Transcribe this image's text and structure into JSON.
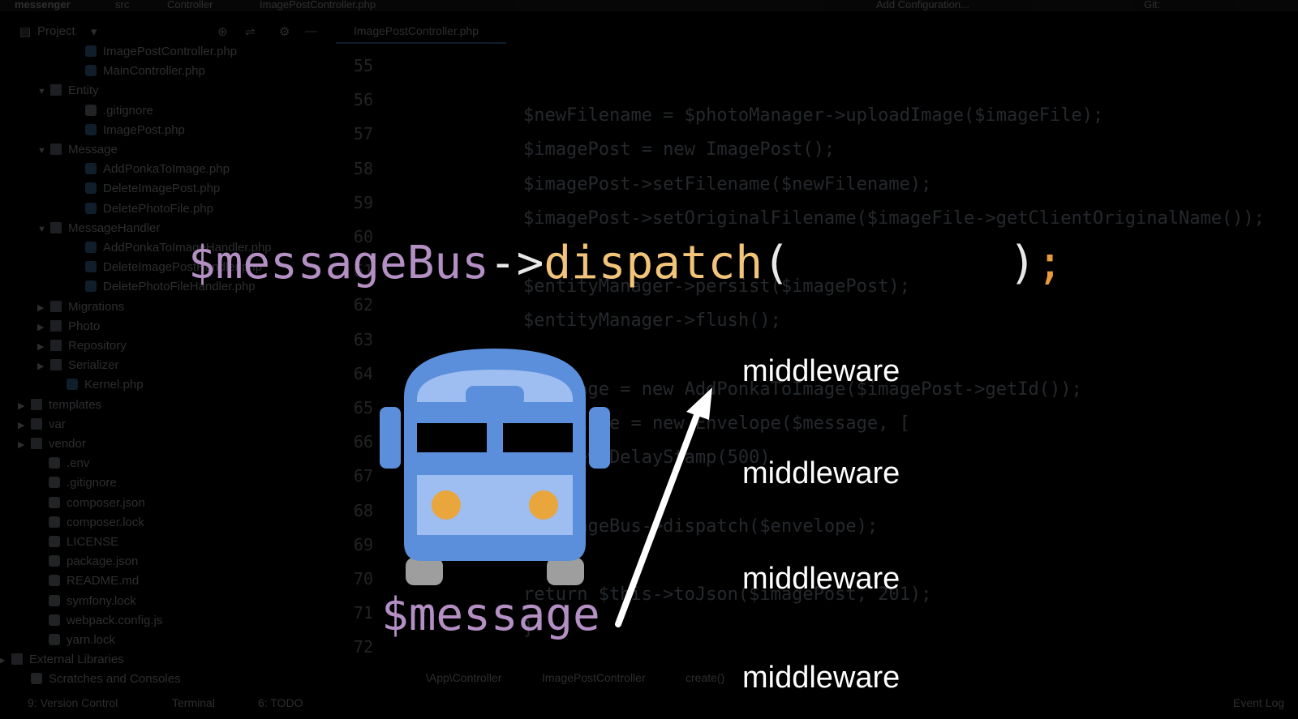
{
  "ide": {
    "topbar": {
      "project": "messenger",
      "path": [
        "src",
        "Controller",
        "ImagePostController.php"
      ],
      "config": "Add Configuration...",
      "git": "Git:"
    },
    "toolbar": {
      "project_label": "Project"
    },
    "editor_tab": "ImagePostController.php",
    "tree": [
      {
        "label": "ImagePostController.php",
        "kind": "php",
        "indent": 105
      },
      {
        "label": "MainController.php",
        "kind": "php",
        "indent": 105
      },
      {
        "label": "Entity",
        "kind": "folder",
        "indent": 62,
        "open": true
      },
      {
        "label": ".gitignore",
        "kind": "file",
        "indent": 105
      },
      {
        "label": "ImagePost.php",
        "kind": "php",
        "indent": 105
      },
      {
        "label": "Message",
        "kind": "folder",
        "indent": 62,
        "open": true
      },
      {
        "label": "AddPonkaToImage.php",
        "kind": "php",
        "indent": 105
      },
      {
        "label": "DeleteImagePost.php",
        "kind": "php",
        "indent": 105
      },
      {
        "label": "DeletePhotoFile.php",
        "kind": "php",
        "indent": 105
      },
      {
        "label": "MessageHandler",
        "kind": "folder",
        "indent": 62,
        "open": true
      },
      {
        "label": "AddPonkaToImageHandler.php",
        "kind": "php",
        "indent": 105
      },
      {
        "label": "DeleteImagePostHandler.php",
        "kind": "php",
        "indent": 105
      },
      {
        "label": "DeletePhotoFileHandler.php",
        "kind": "php",
        "indent": 105
      },
      {
        "label": "Migrations",
        "kind": "folder",
        "indent": 62,
        "open": false
      },
      {
        "label": "Photo",
        "kind": "folder",
        "indent": 62,
        "open": false
      },
      {
        "label": "Repository",
        "kind": "folder",
        "indent": 62,
        "open": false
      },
      {
        "label": "Serializer",
        "kind": "folder",
        "indent": 62,
        "open": false
      },
      {
        "label": "Kernel.php",
        "kind": "php",
        "indent": 82
      },
      {
        "label": "templates",
        "kind": "folder",
        "indent": 38,
        "open": false
      },
      {
        "label": "var",
        "kind": "folder",
        "indent": 38,
        "open": false
      },
      {
        "label": "vendor",
        "kind": "folder",
        "indent": 38,
        "open": false
      },
      {
        "label": ".env",
        "kind": "file",
        "indent": 60
      },
      {
        "label": ".gitignore",
        "kind": "file",
        "indent": 60
      },
      {
        "label": "composer.json",
        "kind": "file",
        "indent": 60
      },
      {
        "label": "composer.lock",
        "kind": "file",
        "indent": 60
      },
      {
        "label": "LICENSE",
        "kind": "file",
        "indent": 60
      },
      {
        "label": "package.json",
        "kind": "file",
        "indent": 60
      },
      {
        "label": "README.md",
        "kind": "file",
        "indent": 60
      },
      {
        "label": "symfony.lock",
        "kind": "file",
        "indent": 60
      },
      {
        "label": "webpack.config.js",
        "kind": "file",
        "indent": 60
      },
      {
        "label": "yarn.lock",
        "kind": "file",
        "indent": 60
      },
      {
        "label": "External Libraries",
        "kind": "folder",
        "indent": 14,
        "open": false
      },
      {
        "label": "Scratches and Consoles",
        "kind": "file",
        "indent": 38
      }
    ],
    "line_numbers": [
      "55",
      "56",
      "57",
      "58",
      "59",
      "60",
      "61",
      "62",
      "63",
      "64",
      "65",
      "66",
      "67",
      "68",
      "69",
      "70",
      "71",
      "72"
    ],
    "code_lines": [
      "",
      "$newFilename = $photoManager->uploadImage($imageFile);",
      "$imagePost = new ImagePost();",
      "$imagePost->setFilename($newFilename);",
      "$imagePost->setOriginalFilename($imageFile->getClientOriginalName());",
      "",
      "$entityManager->persist($imagePost);",
      "$entityManager->flush();",
      "",
      "$message = new AddPonkaToImage($imagePost->getId());",
      "$envelope = new Envelope($message, [",
      "    new DelayStamp(500)",
      "]);",
      "$messageBus->dispatch($envelope);",
      "",
      "return $this->toJson($imagePost, 201);",
      "}",
      ""
    ],
    "breadcrumb": [
      "\\App\\Controller",
      "ImagePostController",
      "create()"
    ],
    "status": {
      "vcs": "9: Version Control",
      "terminal": "Terminal",
      "todo": "6: TODO",
      "events": "Event Log"
    }
  },
  "overlay": {
    "dispatch": {
      "var": "$messageBus",
      "arrow": "->",
      "fn": "dispatch",
      "open": "(",
      "gap": "        ",
      "close": ")",
      "semi": ";"
    },
    "message_label": "$message",
    "middlewares": [
      "middleware",
      "middleware",
      "middleware",
      "middleware"
    ],
    "colors": {
      "bus_body": "#5b8fdb",
      "bus_light": "#9ebdf0",
      "headlight": "#e8a63c",
      "wheel": "#9e9e9e",
      "var": "#b48fc4",
      "fn": "#f2c47a"
    }
  }
}
